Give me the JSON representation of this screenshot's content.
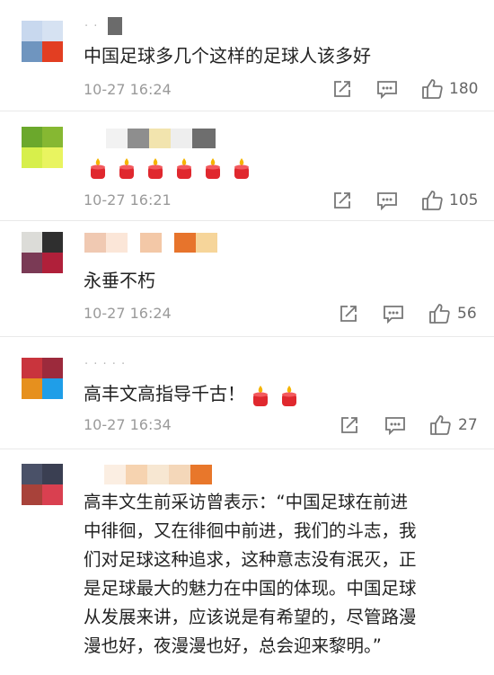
{
  "comments": [
    {
      "text": "中国足球多几个这样的足球人该多好",
      "time": "10-27 16:24",
      "likes": "180",
      "name": "· ·"
    },
    {
      "text": "",
      "time": "10-27 16:21",
      "likes": "105",
      "candles": 6
    },
    {
      "text": "永垂不朽",
      "time": "10-27 16:24",
      "likes": "56"
    },
    {
      "text": "高丰文高指导千古！",
      "time": "10-27 16:34",
      "likes": "27",
      "candles": 2,
      "name": "· · · · ·"
    },
    {
      "lines": [
        "高丰文生前采访曾表示：“中国足球在前进",
        "中徘徊，又在徘徊中前进，我们的斗志，我",
        "们对足球这种追求，这种意志没有泯灭，正",
        "是足球最大的魅力在中国的体现。中国足球",
        "从发展来讲，应该说是有希望的，尽管路漫",
        "漫也好，夜漫漫也好，总会迎来黎明。”"
      ]
    }
  ],
  "colors": {
    "divider": "#e9e9e9",
    "icon": "#777777",
    "text": "#222222",
    "time": "#9a9a9a",
    "candle": "#e0282e",
    "flame": "#f5b400"
  },
  "icons": {
    "share": "share-icon",
    "comment": "comment-icon",
    "like": "thumbs-up-icon"
  }
}
